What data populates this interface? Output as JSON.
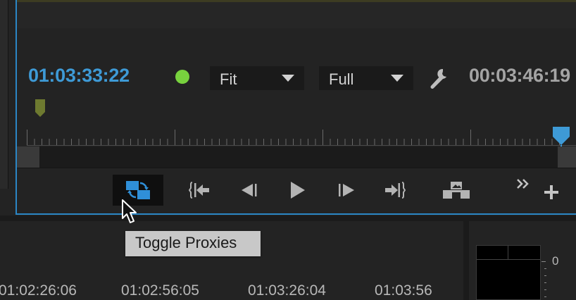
{
  "monitor": {
    "current_timecode": "01:03:33:22",
    "duration_timecode": "00:03:46:19",
    "zoom_select": {
      "value": "Fit"
    },
    "resolution_select": {
      "value": "Full"
    }
  },
  "transport": {
    "buttons": [
      {
        "name": "toggle-proxies",
        "icon": "toggle-proxies-icon"
      },
      {
        "name": "go-to-in",
        "icon": "go-to-in-icon"
      },
      {
        "name": "step-back",
        "icon": "step-back-icon"
      },
      {
        "name": "play",
        "icon": "play-icon"
      },
      {
        "name": "step-forward",
        "icon": "step-forward-icon"
      },
      {
        "name": "go-to-out",
        "icon": "go-to-out-icon"
      },
      {
        "name": "export-frame",
        "icon": "export-frame-icon"
      },
      {
        "name": "more",
        "icon": "double-chevron-icon"
      },
      {
        "name": "add",
        "icon": "plus-icon"
      }
    ]
  },
  "tooltip": {
    "text": "Toggle Proxies"
  },
  "sequence_ruler": {
    "timecodes": [
      "01:02:26:06",
      "01:02:56:05",
      "01:03:26:04",
      "01:03:56"
    ]
  },
  "audio_meter": {
    "label": "0"
  },
  "colors": {
    "accent_blue": "#3e9ad6",
    "panel_border": "#2b86c5",
    "record_green": "#78d23e",
    "in_marker": "#6e7a30"
  }
}
